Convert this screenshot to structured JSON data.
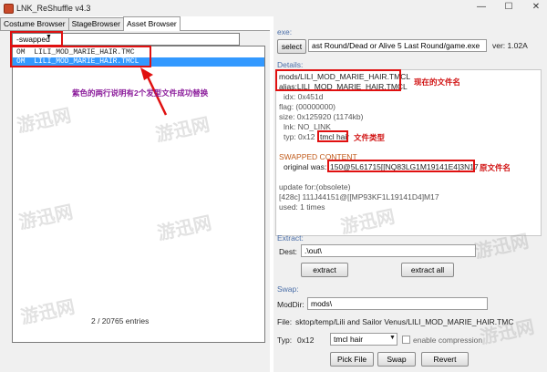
{
  "window": {
    "title": "LNK_ReShuffle v4.3",
    "controls": [
      "—",
      "☐",
      "✕"
    ]
  },
  "tabs": [
    "Costume Browser",
    "StageBrowser",
    "Asset Browser"
  ],
  "left": {
    "filter_value": "-swapped",
    "items": [
      "OM  LILI_MOD_MARIE_HAIR.TMC",
      "OM  LILI_MOD_MARIE_HAIR.TMCL"
    ],
    "entries": "2 / 20765 entries",
    "annotation": "紫色的两行说明有2个发型文件成功替换"
  },
  "exe": {
    "label": "exe:",
    "select_label": "select",
    "path": "ast Round/Dead or Alive 5 Last Round/game.exe",
    "version": "ver: 1.02A"
  },
  "details": {
    "label": "Details:",
    "mods": "mods/LILI_MOD_MARIE_HAIR.TMCL",
    "alias": "alias:LILI_MOD_MARIE_HAIR.TMCL",
    "idx": "idx: 0x451d",
    "flag": "flag:  (00000000)",
    "size": "size: 0x125920 (1174kb)",
    "lnk": "lnk: NO_LINK",
    "typ_prefix": "typ: 0x12",
    "typ_value": "tmcl hair",
    "swapped_title": "SWAPPED CONTENT",
    "original_prefix": "original was:",
    "original_value": "150@5L61715[[NQ83LG1M19141E4]3N17",
    "update": "update for:(obsolete)",
    "update_line": "[428c] 111J44151@[[MP93KF1L19141D4]M17",
    "used": "used: 1 times",
    "note_current": "现在的文件名",
    "note_type": "文件类型",
    "note_original": "原文件名"
  },
  "extract": {
    "label": "Extract:",
    "dest_label": "Dest:",
    "dest_value": ".\\out\\",
    "extract_btn": "extract",
    "extract_all_btn": "extract all"
  },
  "swap": {
    "label": "Swap:",
    "moddir_label": "ModDir:",
    "moddir_value": "mods\\",
    "file_label": "File:",
    "file_value": "sktop/temp/Lili and Sailor Venus/LILI_MOD_MARIE_HAIR.TMC",
    "typ_label": "Typ:",
    "typ_code": "0x12",
    "typ_select": "tmcl hair",
    "compression": "enable compression",
    "pick_btn": "Pick File",
    "swap_btn": "Swap",
    "revert_btn": "Revert"
  },
  "colors": {
    "annotation_red": "#e01010",
    "annotation_purple": "#8a1a9a",
    "section_blue": "#4a6ea8",
    "selection": "#3399ff"
  }
}
